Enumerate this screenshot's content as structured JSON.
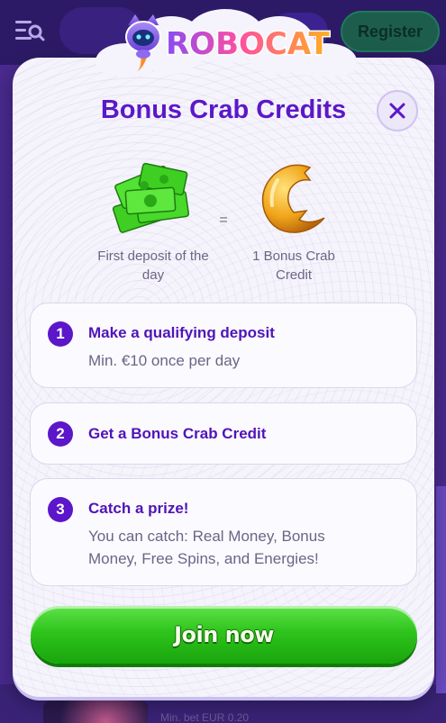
{
  "background": {
    "register_label": "Register",
    "min_bet_text": "Min. bet EUR 0.20"
  },
  "brand": {
    "logo_text": "ROBOCAT"
  },
  "modal": {
    "title": "Bonus Crab Credits",
    "left_caption": "First deposit of the day",
    "equals": "=",
    "right_caption": "1 Bonus Crab Credit",
    "steps": [
      {
        "number": "1",
        "title": "Make a qualifying deposit",
        "description": "Min. €10 once per day"
      },
      {
        "number": "2",
        "title": "Get a Bonus Crab Credit",
        "description": ""
      },
      {
        "number": "3",
        "title": "Catch a prize!",
        "description": "You can catch: Real Money, Bonus Money, Free Spins, and Energies!"
      }
    ],
    "join_label": "Join now"
  },
  "colors": {
    "accent_purple": "#5b17c9",
    "join_green": "#2ec41c",
    "header_bg": "#2d1a66"
  },
  "icons": {
    "menu": "menu-search-icon",
    "close": "close-icon",
    "money": "cash-stack-icon",
    "coin": "crab-coin-icon"
  }
}
